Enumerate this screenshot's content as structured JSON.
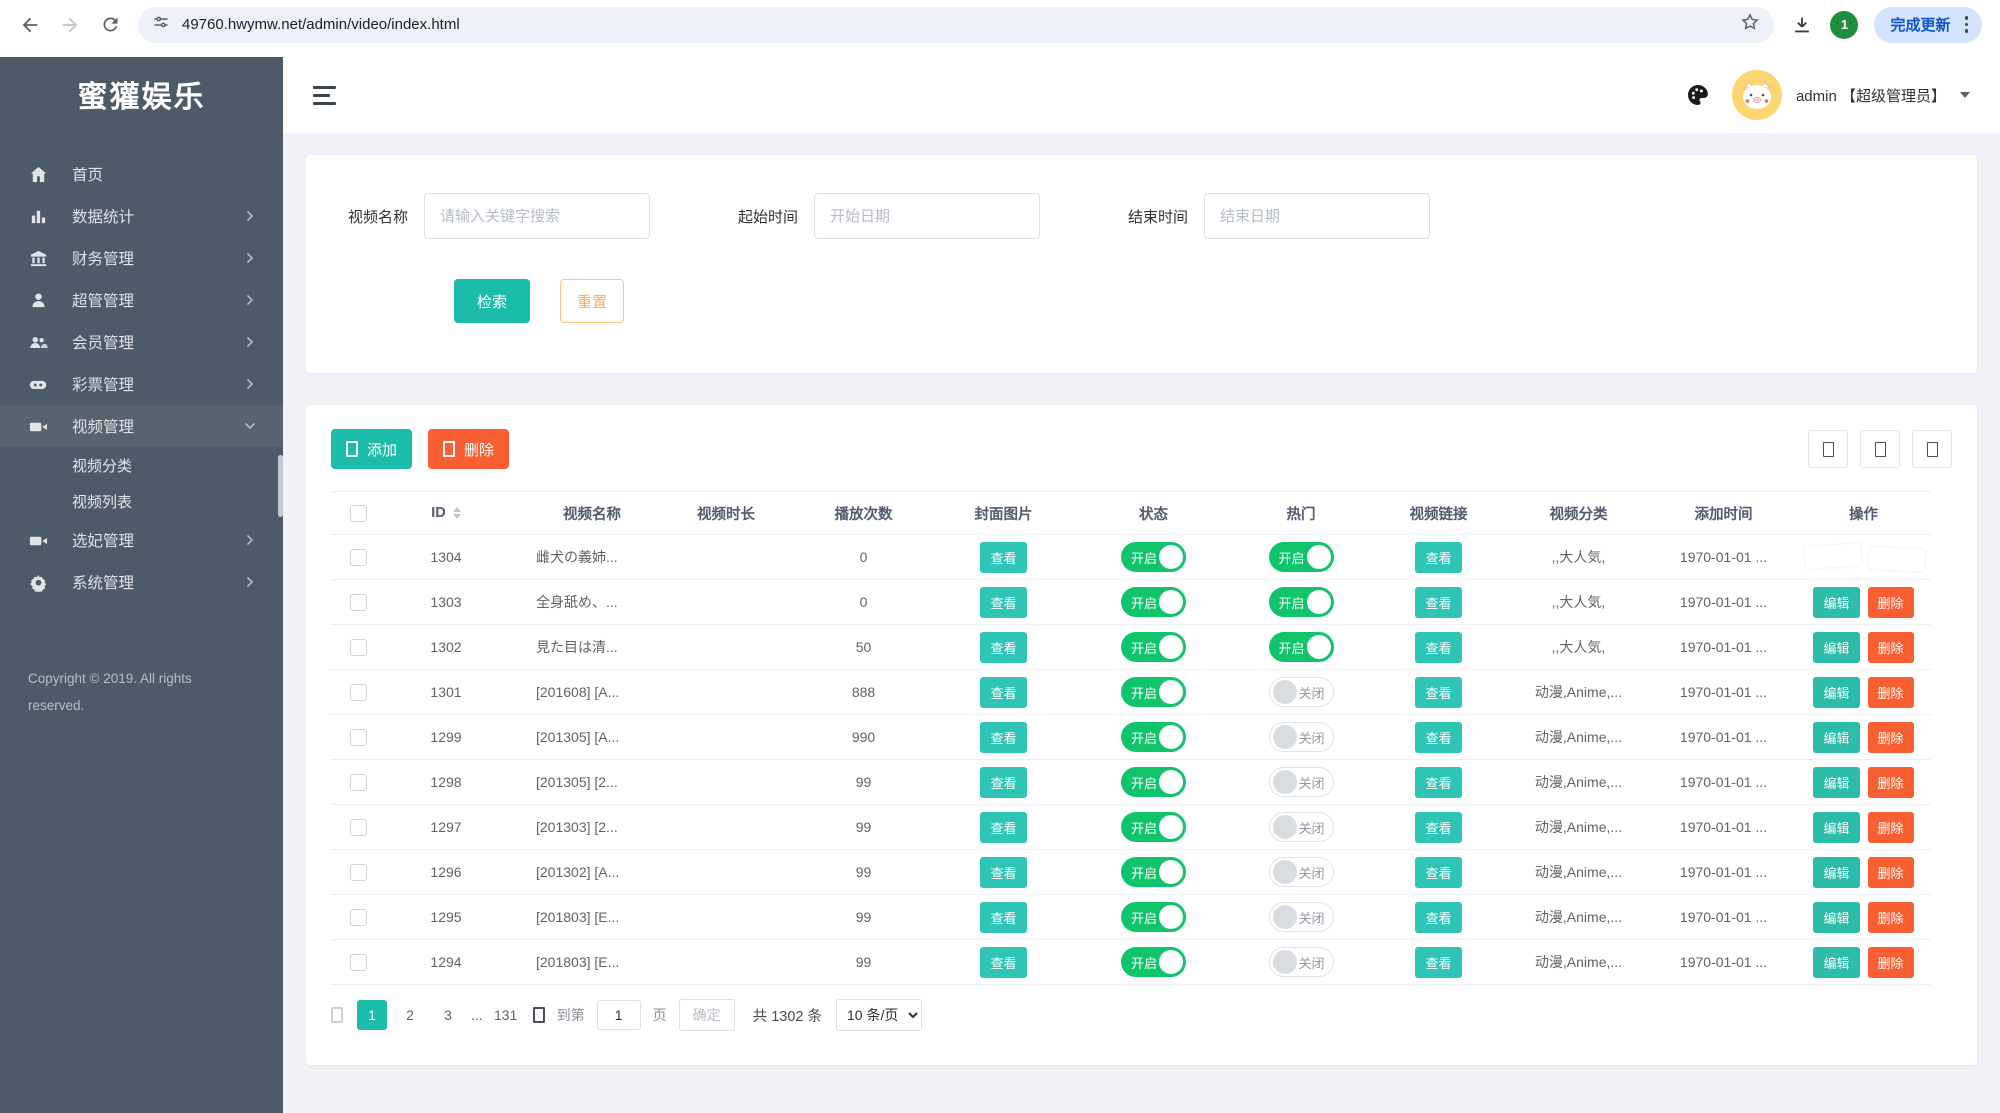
{
  "browser": {
    "url": "49760.hwymw.net/admin/video/index.html",
    "profile_badge": "1",
    "update_button": "完成更新"
  },
  "colors": {
    "teal": "#1cbcab",
    "toggle_green": "#0fc46a",
    "delete_red": "#f95f32",
    "reset_orange": "#f9ae4b",
    "sidebar_bg": "#4d5a68"
  },
  "sidebar": {
    "logo": "蜜獾娱乐",
    "items": [
      {
        "icon": "home-icon",
        "label": "首页",
        "arrow": ""
      },
      {
        "icon": "chart-icon",
        "label": "数据统计",
        "arrow": "right"
      },
      {
        "icon": "bank-icon",
        "label": "财务管理",
        "arrow": "right"
      },
      {
        "icon": "user-icon",
        "label": "超管管理",
        "arrow": "right"
      },
      {
        "icon": "users-icon",
        "label": "会员管理",
        "arrow": "right"
      },
      {
        "icon": "gamepad-icon",
        "label": "彩票管理",
        "arrow": "right"
      },
      {
        "icon": "video-icon",
        "label": "视频管理",
        "arrow": "down",
        "active": true,
        "children": [
          "视频分类",
          "视频列表"
        ]
      },
      {
        "icon": "camera-icon",
        "label": "选妃管理",
        "arrow": "right"
      },
      {
        "icon": "gear-icon",
        "label": "系统管理",
        "arrow": "right"
      }
    ],
    "copyright": "Copyright © 2019. All rights reserved."
  },
  "header": {
    "username": "admin 【超级管理员】"
  },
  "search": {
    "fields": [
      {
        "label": "视频名称",
        "placeholder": "请输入关键字搜索"
      },
      {
        "label": "起始时间",
        "placeholder": "开始日期"
      },
      {
        "label": "结束时间",
        "placeholder": "结束日期"
      }
    ],
    "search_label": "检索",
    "reset_label": "重置"
  },
  "table": {
    "add_label": "添加",
    "delete_label": "删除",
    "view_label": "查看",
    "edit_label": "编辑",
    "delete_row_label": "删除",
    "toggle_on": "开启",
    "toggle_off": "关闭",
    "columns": [
      {
        "label": "",
        "type": "checkbox"
      },
      {
        "label": "ID",
        "sortable": true
      },
      {
        "label": "视频名称"
      },
      {
        "label": "视频时长"
      },
      {
        "label": "播放次数"
      },
      {
        "label": "封面图片"
      },
      {
        "label": "状态"
      },
      {
        "label": "热门"
      },
      {
        "label": "视频链接"
      },
      {
        "label": "视频分类"
      },
      {
        "label": "添加时间"
      },
      {
        "label": "操作"
      }
    ],
    "rows": [
      {
        "id": "1304",
        "name": "雌犬の義姉...",
        "duration": "",
        "plays": "0",
        "status": "on",
        "hot": "on",
        "category": ",,大人気,",
        "time": "1970-01-01 ...",
        "actions": "ghost"
      },
      {
        "id": "1303",
        "name": "全身舐め、...",
        "duration": "",
        "plays": "0",
        "status": "on",
        "hot": "on",
        "category": ",,大人気,",
        "time": "1970-01-01 ...",
        "actions": "buttons"
      },
      {
        "id": "1302",
        "name": "見た目は清...",
        "duration": "",
        "plays": "50",
        "status": "on",
        "hot": "on",
        "category": ",,大人気,",
        "time": "1970-01-01 ...",
        "actions": "buttons"
      },
      {
        "id": "1301",
        "name": "[201608] [A...",
        "duration": "",
        "plays": "888",
        "status": "on",
        "hot": "off",
        "category": "动漫,Anime,...",
        "time": "1970-01-01 ...",
        "actions": "buttons"
      },
      {
        "id": "1299",
        "name": "[201305] [A...",
        "duration": "",
        "plays": "990",
        "status": "on",
        "hot": "off",
        "category": "动漫,Anime,...",
        "time": "1970-01-01 ...",
        "actions": "buttons"
      },
      {
        "id": "1298",
        "name": "[201305] [2...",
        "duration": "",
        "plays": "99",
        "status": "on",
        "hot": "off",
        "category": "动漫,Anime,...",
        "time": "1970-01-01 ...",
        "actions": "buttons"
      },
      {
        "id": "1297",
        "name": "[201303] [2...",
        "duration": "",
        "plays": "99",
        "status": "on",
        "hot": "off",
        "category": "动漫,Anime,...",
        "time": "1970-01-01 ...",
        "actions": "buttons"
      },
      {
        "id": "1296",
        "name": "[201302] [A...",
        "duration": "",
        "plays": "99",
        "status": "on",
        "hot": "off",
        "category": "动漫,Anime,...",
        "time": "1970-01-01 ...",
        "actions": "buttons"
      },
      {
        "id": "1295",
        "name": "[201803] [E...",
        "duration": "",
        "plays": "99",
        "status": "on",
        "hot": "off",
        "category": "动漫,Anime,...",
        "time": "1970-01-01 ...",
        "actions": "buttons"
      },
      {
        "id": "1294",
        "name": "[201803] [E...",
        "duration": "",
        "plays": "99",
        "status": "on",
        "hot": "off",
        "category": "动漫,Anime,...",
        "time": "1970-01-01 ...",
        "actions": "buttons"
      }
    ]
  },
  "pagination": {
    "pages": [
      "1",
      "2",
      "3",
      "...",
      "131"
    ],
    "active": "1",
    "jump_prefix": "到第",
    "jump_value": "1",
    "jump_suffix": "页",
    "confirm_label": "确定",
    "total_label": "共 1302 条",
    "per_page": "10 条/页"
  }
}
